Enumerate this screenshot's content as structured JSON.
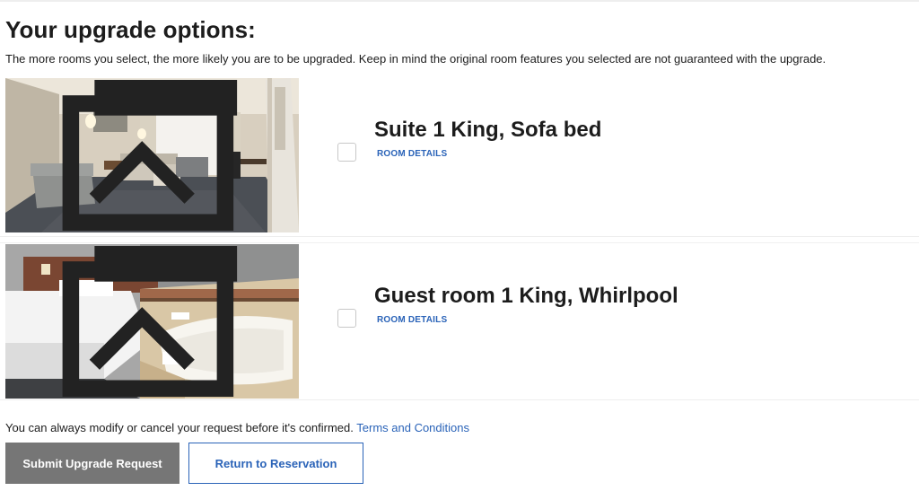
{
  "header": {
    "title": "Your upgrade options:",
    "subtitle": "The more rooms you select, the more likely you are to be upgraded. Keep in mind the original room features you selected are not guaranteed with the upgrade."
  },
  "rooms": [
    {
      "name": "Suite 1 King, Sofa bed",
      "details_link": "ROOM DETAILS",
      "checked": false,
      "photo_icon": "image-badge-icon"
    },
    {
      "name": "Guest room 1 King, Whirlpool",
      "details_link": "ROOM DETAILS",
      "checked": false,
      "photo_icon": "image-badge-icon"
    }
  ],
  "footer": {
    "note": "You can always modify or cancel your request before it's confirmed.",
    "terms_link": "Terms and Conditions"
  },
  "actions": {
    "submit_label": "Submit Upgrade Request",
    "return_label": "Return to Reservation"
  },
  "colors": {
    "link_blue": "#2a63b8",
    "submit_bg": "#767676",
    "text": "#1c1c1c"
  }
}
